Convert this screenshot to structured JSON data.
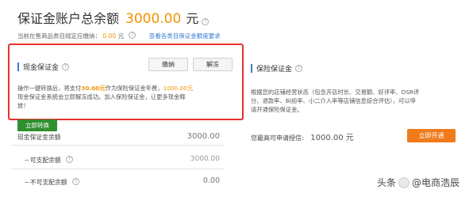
{
  "header": {
    "title": "保证金账户总余额",
    "amount": "3000.00",
    "unit": "元",
    "help_icon": "question-circle-icon",
    "requirement_label": "当前在售商品类目规定应缴纳：",
    "requirement_value": "0.00",
    "requirement_unit": "元",
    "requirement_link": "查看各类目保证金额度要求"
  },
  "cash_deposit": {
    "title": "现金保证金",
    "help_icon": "question-circle-icon",
    "pay_button": "缴纳",
    "unfreeze_button": "解冻",
    "desc_prefix": "操作一键转换后，将支付",
    "desc_pay_amount": "30.00元",
    "desc_middle": "作为保险保证金年费，",
    "desc_release_amount": "1000.00元",
    "desc_line2": "现金保证金系统会立即解冻成功。加入保险保证金，让更多现金释",
    "desc_line3": "放！",
    "convert_button": "立即转换",
    "rows": [
      {
        "label": "现金保证金余额",
        "value": "3000.00"
      },
      {
        "label": "－可支配余额",
        "value": "3000.00"
      },
      {
        "label": "－不可支配余额",
        "value": "0.00"
      }
    ],
    "row_help_icon": "question-circle-icon"
  },
  "insurance_deposit": {
    "title": "保险保证金",
    "help_icon": "question-circle-icon",
    "desc_line1": "根据您的店铺经营状态（包含开店时长、交易额、好评率、DSR评",
    "desc_line2": "分、退款率、纠纷率、小二介入率等店铺信息综合评估），可以申",
    "desc_line3": "请开通保险保证金。",
    "max_label": "您最高可申请授信:",
    "max_amount": "1000.00 元",
    "open_button": "立即开通"
  },
  "watermark": {
    "text_left": "头条",
    "text_right": "@电商浩辰",
    "logo_icon": "avatar-icon"
  },
  "colors": {
    "accent_orange": "#f29400",
    "red_highlight": "#e8302b",
    "green_button": "#2f8f2f",
    "orange_button": "#f07b1a",
    "link_blue": "#3a7bd5"
  }
}
